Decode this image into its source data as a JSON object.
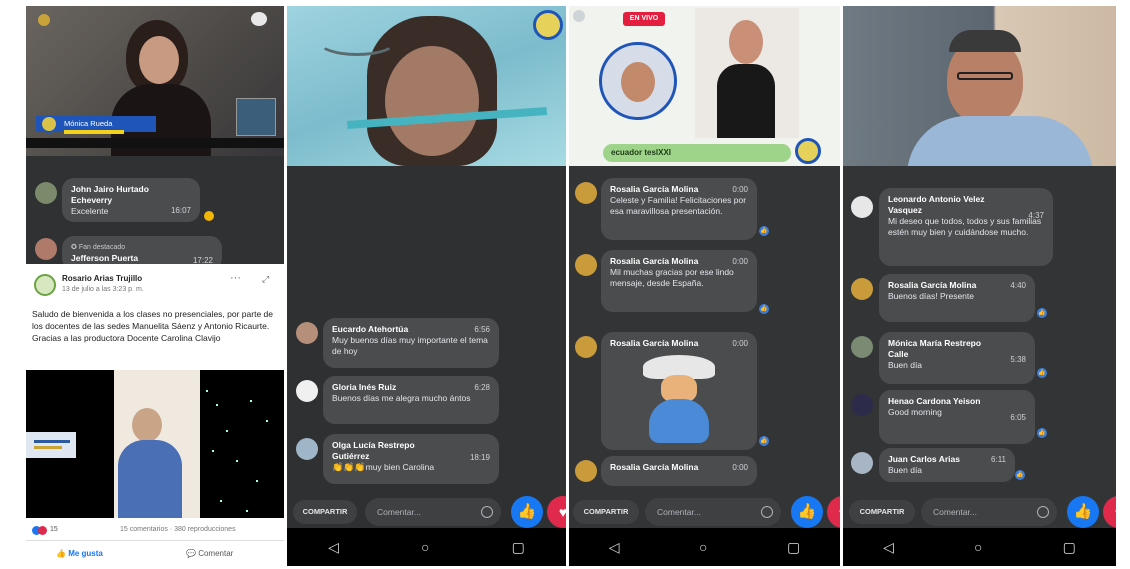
{
  "panel1": {
    "lower_third_name": "Mónica Rueda",
    "comments": [
      {
        "name": "John Jairo Hurtado Echeverry",
        "text": "Excelente",
        "time": "16:07"
      },
      {
        "badge": "Fan destacado",
        "name": "Jefferson Puerta",
        "time": "17:22"
      }
    ],
    "post": {
      "page_name": "Rosario Arias Trujillo",
      "date": "13 de julio a las 3:23 p. m.",
      "text": "Saludo de bienvenida a los clases no presenciales, por parte de los docentes de las sedes Manuelita Sáenz y Antonio Ricaurte. Gracias a las productora Docente Carolina Clavijo",
      "reaction_count": "15",
      "stats": "15 comentarios · 380 reproducciones",
      "like_label": "Me gusta",
      "comment_label": "Comentar"
    }
  },
  "panel2": {
    "comments": [
      {
        "name": "Eucardo Atehortúa",
        "time": "6:56",
        "text": "Muy buenos días muy importante el tema de hoy"
      },
      {
        "name": "Gloria Inés Ruiz",
        "time": "6:28",
        "text": "Buenos días me alegra mucho ántos"
      },
      {
        "name": "Olga Lucía Restrepo Gutiérrez",
        "time": "18:19",
        "text": "muy bien Carolina",
        "emoji": "👏👏👏"
      }
    ],
    "share_label": "COMPARTIR",
    "comment_placeholder": "Comentar..."
  },
  "panel3": {
    "live_badge": "EN VIVO",
    "banner_text": "ecuador teslXXI",
    "comments": [
      {
        "name": "Rosalia García Molina",
        "time": "0:00",
        "text": "Celeste y Familia! Felicitaciones por esa maravillosa presentación."
      },
      {
        "name": "Rosalia García Molina",
        "time": "0:00",
        "text": "Mil muchas gracias por ese lindo mensaje, desde España."
      },
      {
        "name": "Rosalia García Molina",
        "time": "0:00",
        "text": ""
      },
      {
        "name": "Rosalia García Molina",
        "time": "0:00",
        "text": ""
      }
    ],
    "share_label": "COMPARTIR",
    "comment_placeholder": "Comentar..."
  },
  "panel4": {
    "comments": [
      {
        "name": "Leonardo Antonio Velez Vasquez",
        "time": "4:37",
        "text": "Mi deseo que todos, todos y sus familias estén muy bien y cuidándose mucho."
      },
      {
        "name": "Rosalia García Molina",
        "time": "4:40",
        "text": "Buenos días! Presente"
      },
      {
        "name": "Mónica María Restrepo Calle",
        "time": "5:38",
        "text": "Buen día"
      },
      {
        "name": "Henao Cardona Yeison",
        "time": "6:05",
        "text": "Good morning"
      },
      {
        "name": "Juan Carlos Arias",
        "time": "6:11",
        "text": "Buen día"
      }
    ],
    "share_label": "COMPARTIR",
    "comment_placeholder": "Comentar..."
  },
  "colors": {
    "accent": "#1877f2",
    "heart": "#e02a4b",
    "bubble": "#4a4c4e",
    "dark_bg": "#323436",
    "live": "#e41e3f"
  },
  "icons": {
    "like": "thumbs-up-icon",
    "heart": "heart-icon",
    "emoji": "smiley-icon",
    "back": "back-triangle-icon",
    "home": "home-circle-icon",
    "recents": "recents-square-icon"
  }
}
